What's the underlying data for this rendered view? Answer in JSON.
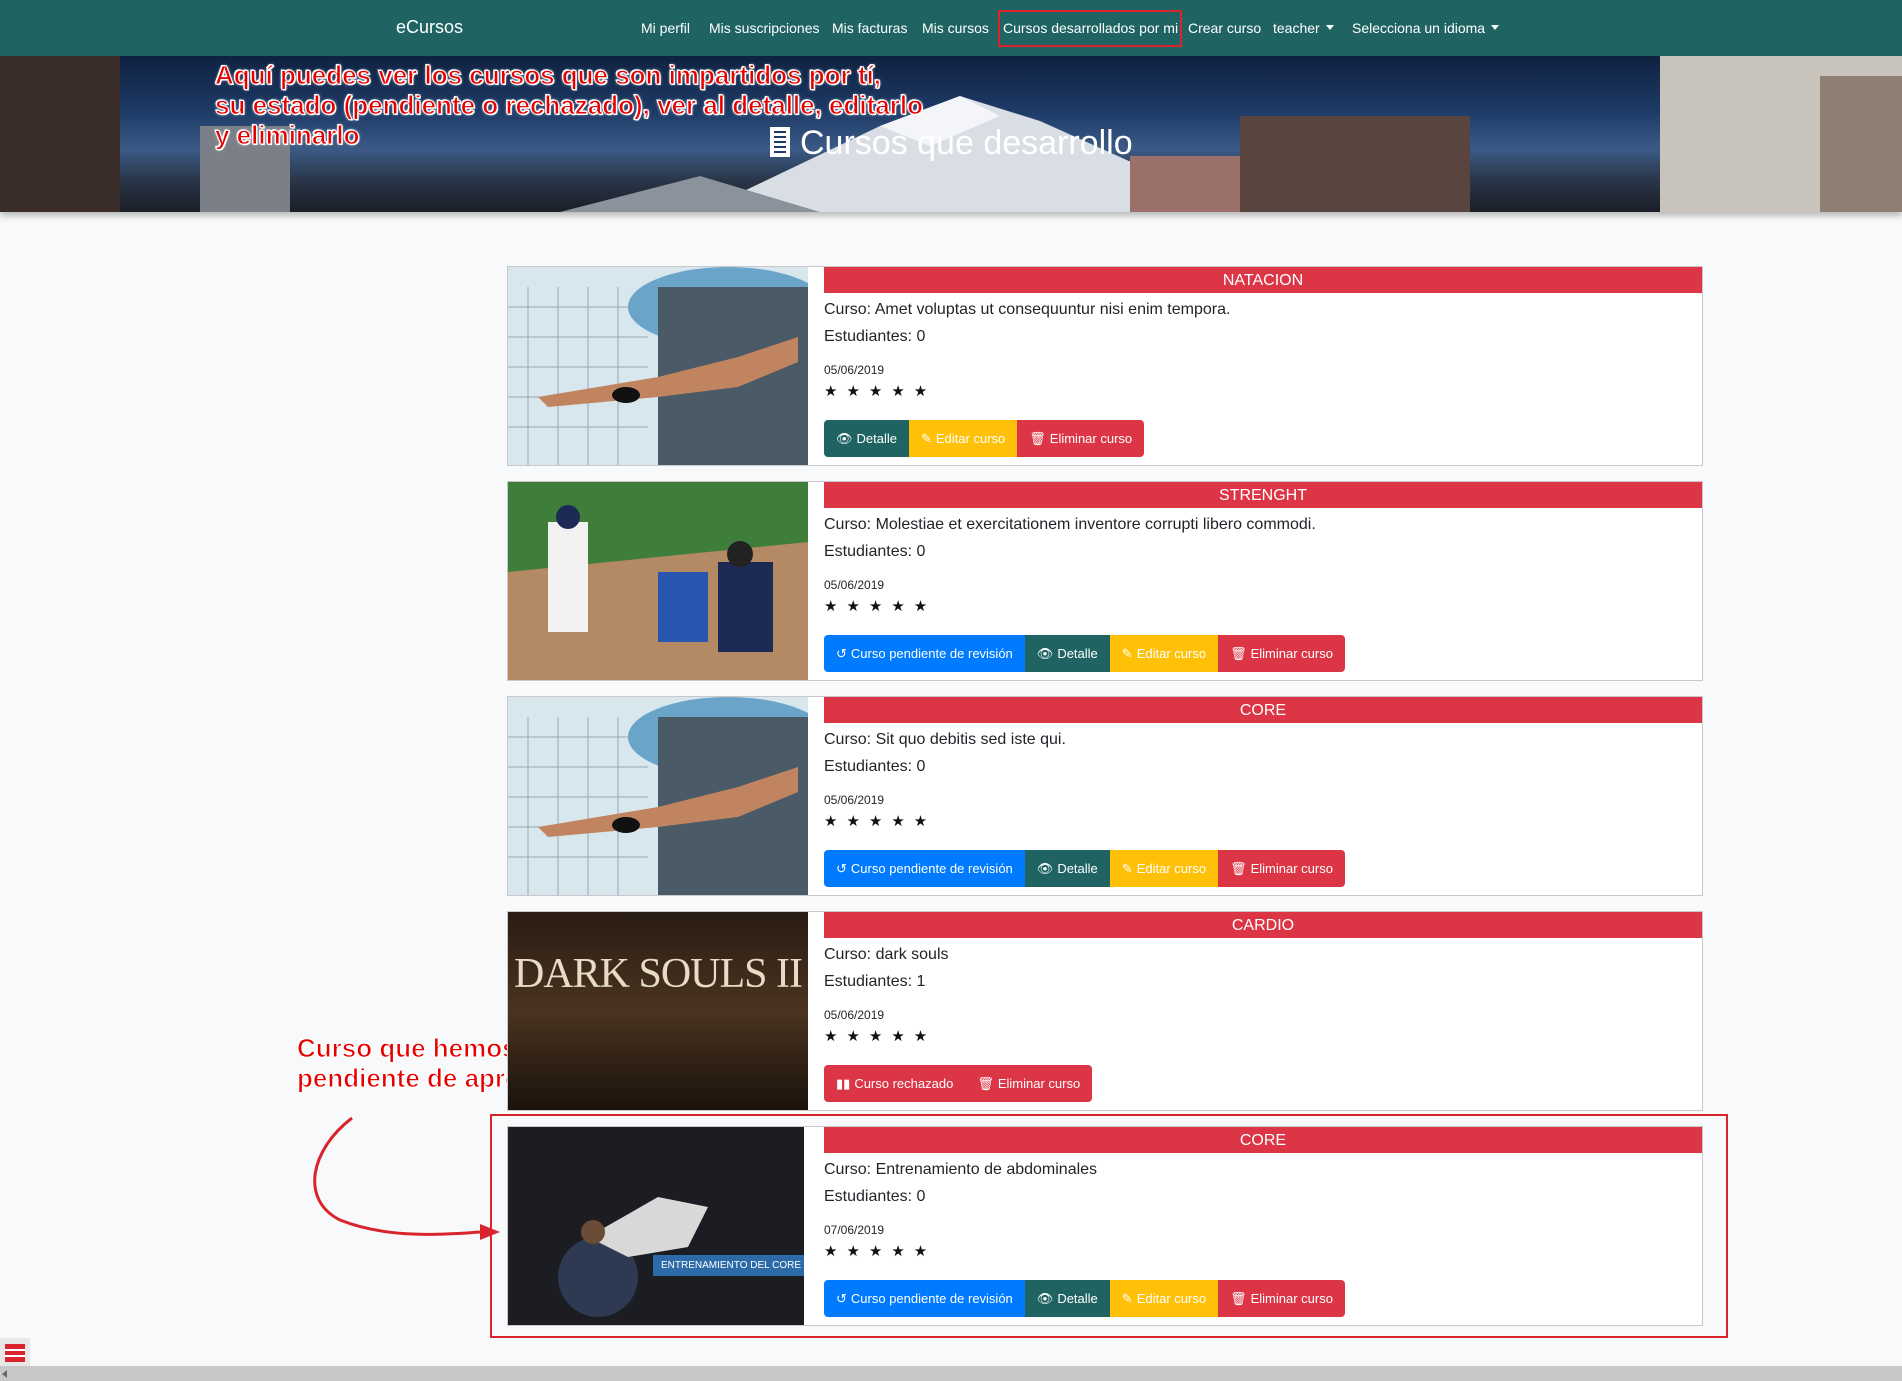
{
  "nav": {
    "brand": "eCursos",
    "items": [
      {
        "label": "Mi perfil"
      },
      {
        "label": "Mis suscripciones"
      },
      {
        "label": "Mis facturas"
      },
      {
        "label": "Mis cursos"
      },
      {
        "label": "Cursos desarrollados por mi"
      },
      {
        "label": "Crear curso"
      },
      {
        "label": "teacher"
      },
      {
        "label": "Selecciona un idioma"
      }
    ]
  },
  "hero": {
    "title": "Cursos que desarrollo"
  },
  "annotations": {
    "top_line1": "Aquí puedes ver los cursos que son impartidos por tí,",
    "top_line2": "su estado (pendiente o rechazado), ver al detalle, editarlo",
    "top_line3": "y eliminarlo",
    "bottom_line1": "Curso que hemos creado previamente,",
    "bottom_line2": "pendiente de aprobación"
  },
  "courses": [
    {
      "title": "NATACION",
      "description": "Curso: Amet voluptas ut consequuntur nisi enim tempora.",
      "students": "Estudiantes: 0",
      "date": "05/06/2019",
      "stars": "★★★★★",
      "buttons": {
        "detail": "Detalle",
        "edit": "Editar curso",
        "delete": "Eliminar curso"
      }
    },
    {
      "title": "STRENGHT",
      "description": "Curso: Molestiae et exercitationem inventore corrupti libero commodi.",
      "students": "Estudiantes: 0",
      "date": "05/06/2019",
      "stars": "★★★★★",
      "buttons": {
        "status": "Curso pendiente de revisión",
        "detail": "Detalle",
        "edit": "Editar curso",
        "delete": "Eliminar curso"
      }
    },
    {
      "title": "CORE",
      "description": "Curso: Sit quo debitis sed iste qui.",
      "students": "Estudiantes: 0",
      "date": "05/06/2019",
      "stars": "★★★★★",
      "buttons": {
        "status": "Curso pendiente de revisión",
        "detail": "Detalle",
        "edit": "Editar curso",
        "delete": "Eliminar curso"
      }
    },
    {
      "title": "CARDIO",
      "description": "Curso: dark souls",
      "students": "Estudiantes: 1",
      "date": "05/06/2019",
      "stars": "★★★★★",
      "thumb_text": "DARK SOULS II",
      "buttons": {
        "status": "Curso rechazado",
        "delete": "Eliminar curso"
      }
    },
    {
      "title": "CORE",
      "description": "Curso: Entrenamiento de abdominales",
      "students": "Estudiantes: 0",
      "date": "07/06/2019",
      "stars": "★★★★★",
      "thumb_text": "ENTRENAMIENTO DEL CORE",
      "buttons": {
        "status": "Curso pendiente de revisión",
        "detail": "Detalle",
        "edit": "Editar curso",
        "delete": "Eliminar curso"
      }
    }
  ],
  "colors": {
    "navbar": "#1f6463",
    "card_header": "#dc3545",
    "btn_status": "#007bff",
    "btn_detail": "#1f6463",
    "btn_edit": "#ffc107",
    "btn_delete": "#dc3545",
    "annotation": "#e60000"
  }
}
